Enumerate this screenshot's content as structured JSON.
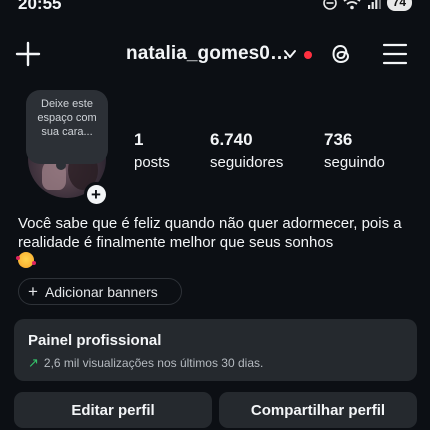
{
  "status_bar": {
    "time": "20:55",
    "battery": "74",
    "icons": [
      "do-not-disturb-icon",
      "wifi-icon",
      "signal-icon",
      "battery-icon"
    ]
  },
  "header": {
    "username": "natalia_gomes0…",
    "icons": [
      "plus-icon",
      "chevron-down-icon",
      "threads-icon",
      "menu-icon"
    ],
    "notification_dot_color": "#ff3040"
  },
  "profile": {
    "note_placeholder": "Deixe este espaço com sua cara...",
    "stats": [
      {
        "value": "1",
        "label": "posts"
      },
      {
        "value": "6.740",
        "label": "seguidores"
      },
      {
        "value": "736",
        "label": "seguindo"
      }
    ],
    "bio": "Você sabe que é feliz quando não quer adormecer, pois a realidade é finalmente melhor que seus sonhos",
    "bio_emoji": "smiling-face-with-hearts"
  },
  "banner_button": {
    "icon": "+",
    "label": "Adicionar banners"
  },
  "professional_panel": {
    "title": "Painel profissional",
    "trend_icon": "↗",
    "trend_color": "#35c46a",
    "summary": "2,6 mil visualizações nos últimos 30 dias."
  },
  "actions": {
    "edit_label": "Editar perfil",
    "share_label": "Compartilhar perfil"
  },
  "colors": {
    "background": "#0c0f14",
    "surface": "#25292e",
    "text": "#f3f5f7"
  }
}
